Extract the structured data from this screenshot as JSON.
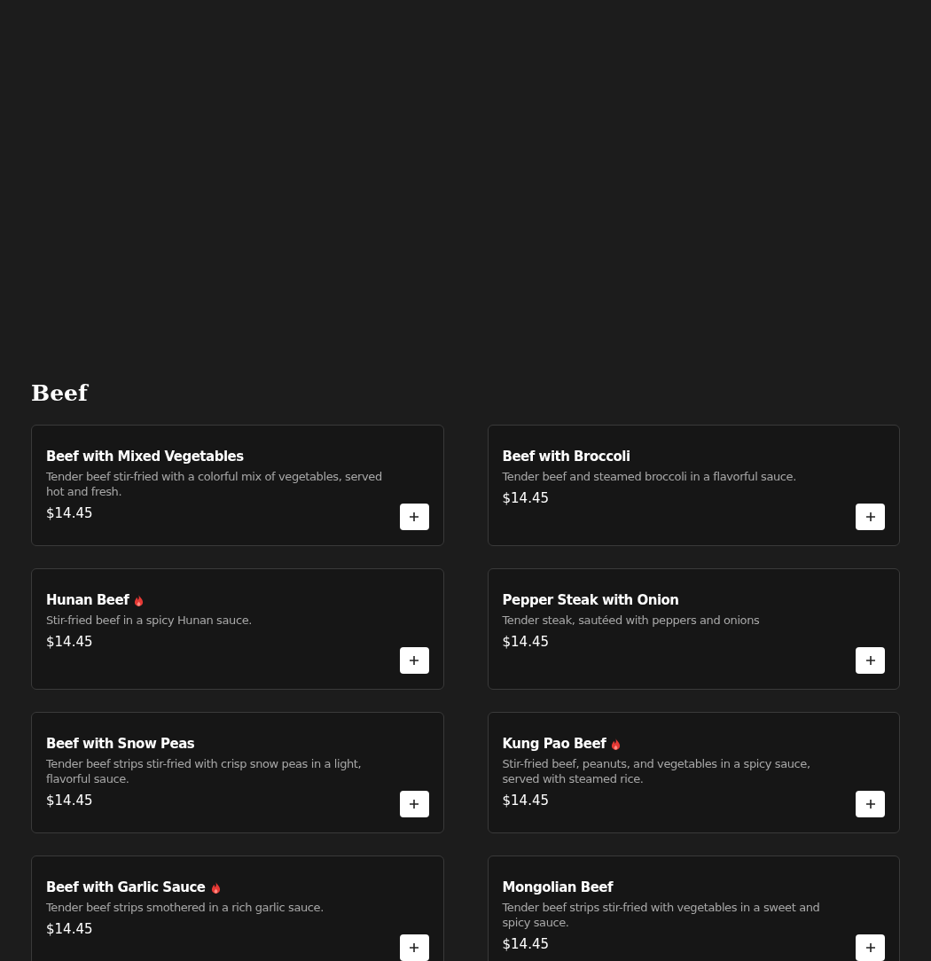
{
  "section_title": "Beef",
  "items": [
    {
      "name": "Beef with Mixed Vegetables",
      "spicy": false,
      "description": "Tender beef stir-fried with a colorful mix of vegetables, served hot and fresh.",
      "price": "$14.45"
    },
    {
      "name": "Beef with Broccoli",
      "spicy": false,
      "description": "Tender beef and steamed broccoli in a flavorful sauce.",
      "price": "$14.45"
    },
    {
      "name": "Hunan Beef",
      "spicy": true,
      "description": "Stir-fried beef in a spicy Hunan sauce.",
      "price": "$14.45"
    },
    {
      "name": "Pepper Steak with Onion",
      "spicy": false,
      "description": "Tender steak, sautéed with peppers and onions",
      "price": "$14.45"
    },
    {
      "name": "Beef with Snow Peas",
      "spicy": false,
      "description": "Tender beef strips stir-fried with crisp snow peas in a light, flavorful sauce.",
      "price": "$14.45"
    },
    {
      "name": "Kung Pao Beef",
      "spicy": true,
      "description": "Stir-fried beef, peanuts, and vegetables in a spicy sauce, served with steamed rice.",
      "price": "$14.45"
    },
    {
      "name": "Beef with Garlic Sauce",
      "spicy": true,
      "description": "Tender beef strips smothered in a rich garlic sauce.",
      "price": "$14.45"
    },
    {
      "name": "Mongolian Beef",
      "spicy": false,
      "description": "Tender beef strips stir-fried with vegetables in a sweet and spicy sauce.",
      "price": "$14.45"
    }
  ]
}
